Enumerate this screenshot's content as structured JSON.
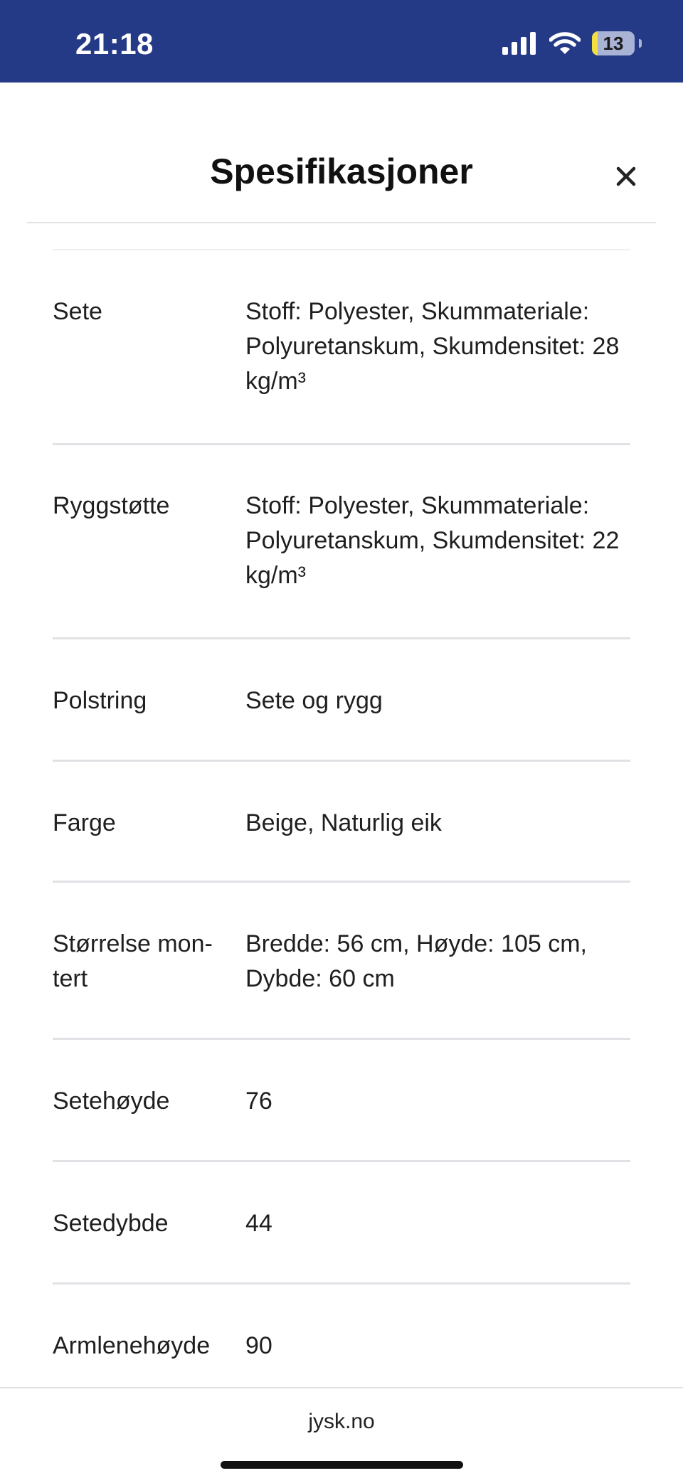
{
  "status_bar": {
    "time": "21:18",
    "battery_level": "13",
    "battery_fraction": 0.13,
    "background_color": "#243a87"
  },
  "sheet": {
    "title": "Spesifikasjoner",
    "close_icon": "close-icon"
  },
  "specs": [
    {
      "label": "Sete",
      "value": "Stoff: Polyester, Skummateriale: Polyuretanskum, Skumdensitet: 28 kg/m³"
    },
    {
      "label": "Ryggstøtte",
      "value": "Stoff: Polyester, Skummateriale: Polyuretanskum, Skumdensitet: 22 kg/m³"
    },
    {
      "label": "Polstring",
      "value": "Sete og rygg"
    },
    {
      "label": "Farge",
      "value": "Beige, Naturlig eik"
    },
    {
      "label": "Størrelse mon­tert",
      "value": "Bredde: 56 cm, Høyde: 105 cm, Dybde: 60 cm"
    },
    {
      "label": "Setehøyde",
      "value": "76"
    },
    {
      "label": "Setedybde",
      "value": "44"
    },
    {
      "label": "Armlenehøyde",
      "value": "90"
    }
  ],
  "browser": {
    "url": "jysk.no"
  }
}
